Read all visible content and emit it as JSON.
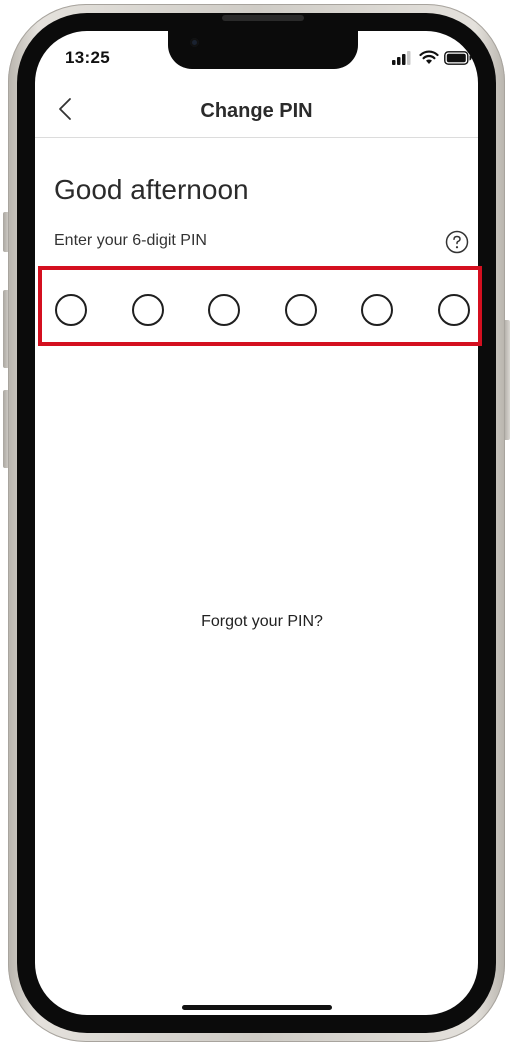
{
  "status_bar": {
    "time": "13:25",
    "signal_icon": "cellular-signal-icon",
    "wifi_icon": "wifi-icon",
    "battery_icon": "battery-icon"
  },
  "header": {
    "back_icon": "chevron-left-icon",
    "title": "Change PIN"
  },
  "main": {
    "greeting": "Good afternoon",
    "pin_prompt": "Enter your 6-digit PIN",
    "help_icon": "question-mark-circle-icon",
    "pin_length": 6,
    "pin_digits_entered": 0,
    "forgot_link": "Forgot your PIN?"
  },
  "colors": {
    "highlight": "#d40f1f",
    "text": "#2b2b2b",
    "background": "#ffffff"
  }
}
